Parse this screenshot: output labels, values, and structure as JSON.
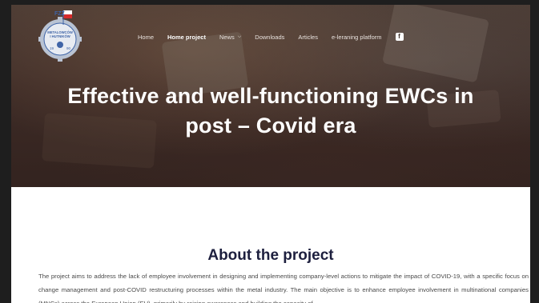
{
  "logo": {
    "top_letters": "FZZ",
    "line1": "METALOWCÓW",
    "line2": "I HUTNIKÓW",
    "year_left": "19",
    "year_right": "90",
    "colors": {
      "red": "#d72b2b",
      "blue": "#3f64a7"
    }
  },
  "nav": {
    "items": [
      {
        "label": "Home"
      },
      {
        "label": "Home project"
      },
      {
        "label": "News"
      },
      {
        "label": "Downloads"
      },
      {
        "label": "Articles"
      },
      {
        "label": "e-leraning platform"
      }
    ],
    "social_icon": "facebook-icon"
  },
  "hero": {
    "title_line1": "Effective and well-functioning EWCs in",
    "title_line2": "post – Covid era"
  },
  "about": {
    "heading": "About the project",
    "paragraph": "The project aims to address the lack of employee involvement in designing and implementing company-level actions to mitigate the impact of COVID-19, with a specific focus on change management and post-COVID restructuring processes within the metal industry. The main objective is to enhance employee involvement in multinational companies (MNCs) across the European Union (EU), primarily by raising awareness and building the capacity of"
  }
}
